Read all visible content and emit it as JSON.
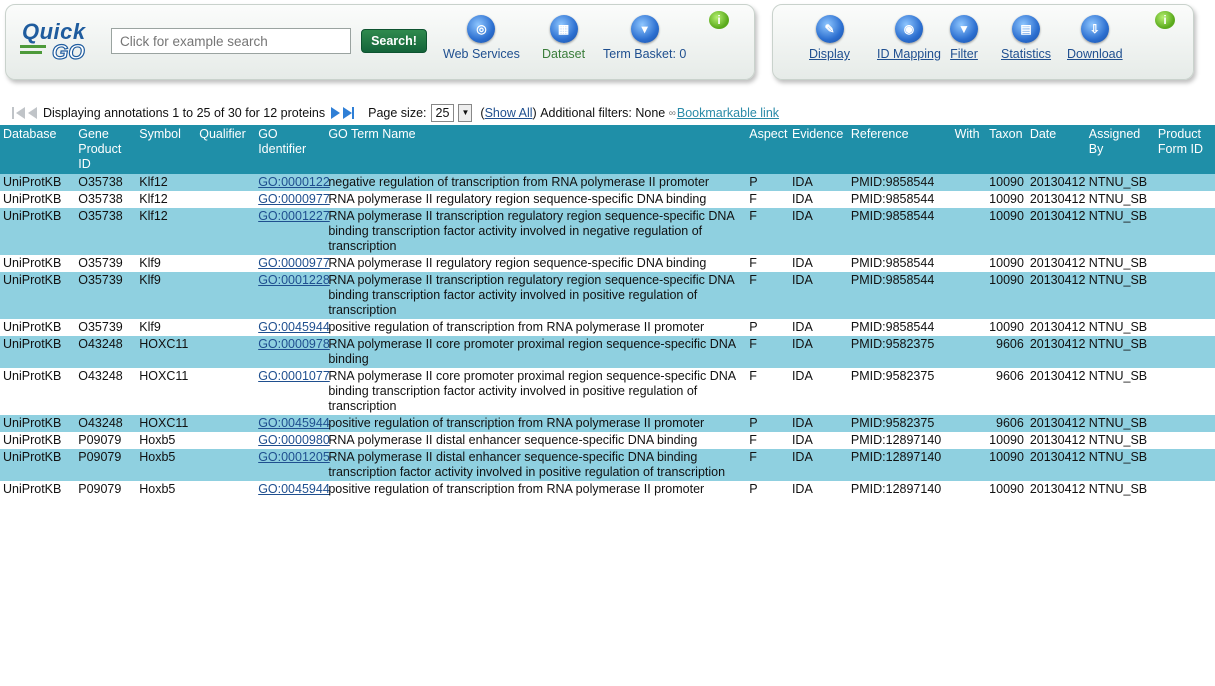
{
  "header": {
    "logo_top": "Quick",
    "logo_bottom": "GO",
    "search_placeholder": "Click for example search",
    "search_button": "Search!",
    "tools_left": [
      "Web Services",
      "Dataset",
      "Term Basket: 0"
    ],
    "tools_right": [
      "Display",
      "ID Mapping",
      "Filter",
      "Statistics",
      "Download"
    ],
    "info_glyph": "i"
  },
  "pager": {
    "status": "Displaying annotations 1 to 25 of 30 for 12 proteins",
    "page_size_label": "Page size:",
    "page_size_value": "25",
    "show_all": "Show All",
    "filters_text": "Additional filters: None",
    "bookmark": "Bookmarkable link"
  },
  "table": {
    "columns": [
      "Database",
      "Gene Product ID",
      "Symbol",
      "Qualifier",
      "GO Identifier",
      "GO Term Name",
      "Aspect",
      "Evidence",
      "Reference",
      "With",
      "Taxon",
      "Date",
      "Assigned By",
      "Product Form ID"
    ],
    "rows": [
      [
        "UniProtKB",
        "O35738",
        "Klf12",
        "",
        "GO:0000122",
        "negative regulation of transcription from RNA polymerase II promoter",
        "P",
        "IDA",
        "PMID:9858544",
        "",
        "10090",
        "20130412",
        "NTNU_SB",
        ""
      ],
      [
        "UniProtKB",
        "O35738",
        "Klf12",
        "",
        "GO:0000977",
        "RNA polymerase II regulatory region sequence-specific DNA binding",
        "F",
        "IDA",
        "PMID:9858544",
        "",
        "10090",
        "20130412",
        "NTNU_SB",
        ""
      ],
      [
        "UniProtKB",
        "O35738",
        "Klf12",
        "",
        "GO:0001227",
        "RNA polymerase II transcription regulatory region sequence-specific DNA binding transcription factor activity involved in negative regulation of transcription",
        "F",
        "IDA",
        "PMID:9858544",
        "",
        "10090",
        "20130412",
        "NTNU_SB",
        ""
      ],
      [
        "UniProtKB",
        "O35739",
        "Klf9",
        "",
        "GO:0000977",
        "RNA polymerase II regulatory region sequence-specific DNA binding",
        "F",
        "IDA",
        "PMID:9858544",
        "",
        "10090",
        "20130412",
        "NTNU_SB",
        ""
      ],
      [
        "UniProtKB",
        "O35739",
        "Klf9",
        "",
        "GO:0001228",
        "RNA polymerase II transcription regulatory region sequence-specific DNA binding transcription factor activity involved in positive regulation of transcription",
        "F",
        "IDA",
        "PMID:9858544",
        "",
        "10090",
        "20130412",
        "NTNU_SB",
        ""
      ],
      [
        "UniProtKB",
        "O35739",
        "Klf9",
        "",
        "GO:0045944",
        "positive regulation of transcription from RNA polymerase II promoter",
        "P",
        "IDA",
        "PMID:9858544",
        "",
        "10090",
        "20130412",
        "NTNU_SB",
        ""
      ],
      [
        "UniProtKB",
        "O43248",
        "HOXC11",
        "",
        "GO:0000978",
        "RNA polymerase II core promoter proximal region sequence-specific DNA binding",
        "F",
        "IDA",
        "PMID:9582375",
        "",
        "9606",
        "20130412",
        "NTNU_SB",
        ""
      ],
      [
        "UniProtKB",
        "O43248",
        "HOXC11",
        "",
        "GO:0001077",
        "RNA polymerase II core promoter proximal region sequence-specific DNA binding transcription factor activity involved in positive regulation of transcription",
        "F",
        "IDA",
        "PMID:9582375",
        "",
        "9606",
        "20130412",
        "NTNU_SB",
        ""
      ],
      [
        "UniProtKB",
        "O43248",
        "HOXC11",
        "",
        "GO:0045944",
        "positive regulation of transcription from RNA polymerase II promoter",
        "P",
        "IDA",
        "PMID:9582375",
        "",
        "9606",
        "20130412",
        "NTNU_SB",
        ""
      ],
      [
        "UniProtKB",
        "P09079",
        "Hoxb5",
        "",
        "GO:0000980",
        "RNA polymerase II distal enhancer sequence-specific DNA binding",
        "F",
        "IDA",
        "PMID:12897140",
        "",
        "10090",
        "20130412",
        "NTNU_SB",
        ""
      ],
      [
        "UniProtKB",
        "P09079",
        "Hoxb5",
        "",
        "GO:0001205",
        "RNA polymerase II distal enhancer sequence-specific DNA binding transcription factor activity involved in positive regulation of transcription",
        "F",
        "IDA",
        "PMID:12897140",
        "",
        "10090",
        "20130412",
        "NTNU_SB",
        ""
      ],
      [
        "UniProtKB",
        "P09079",
        "Hoxb5",
        "",
        "GO:0045944",
        "positive regulation of transcription from RNA polymerase II promoter",
        "P",
        "IDA",
        "PMID:12897140",
        "",
        "10090",
        "20130412",
        "NTNU_SB",
        ""
      ]
    ]
  }
}
